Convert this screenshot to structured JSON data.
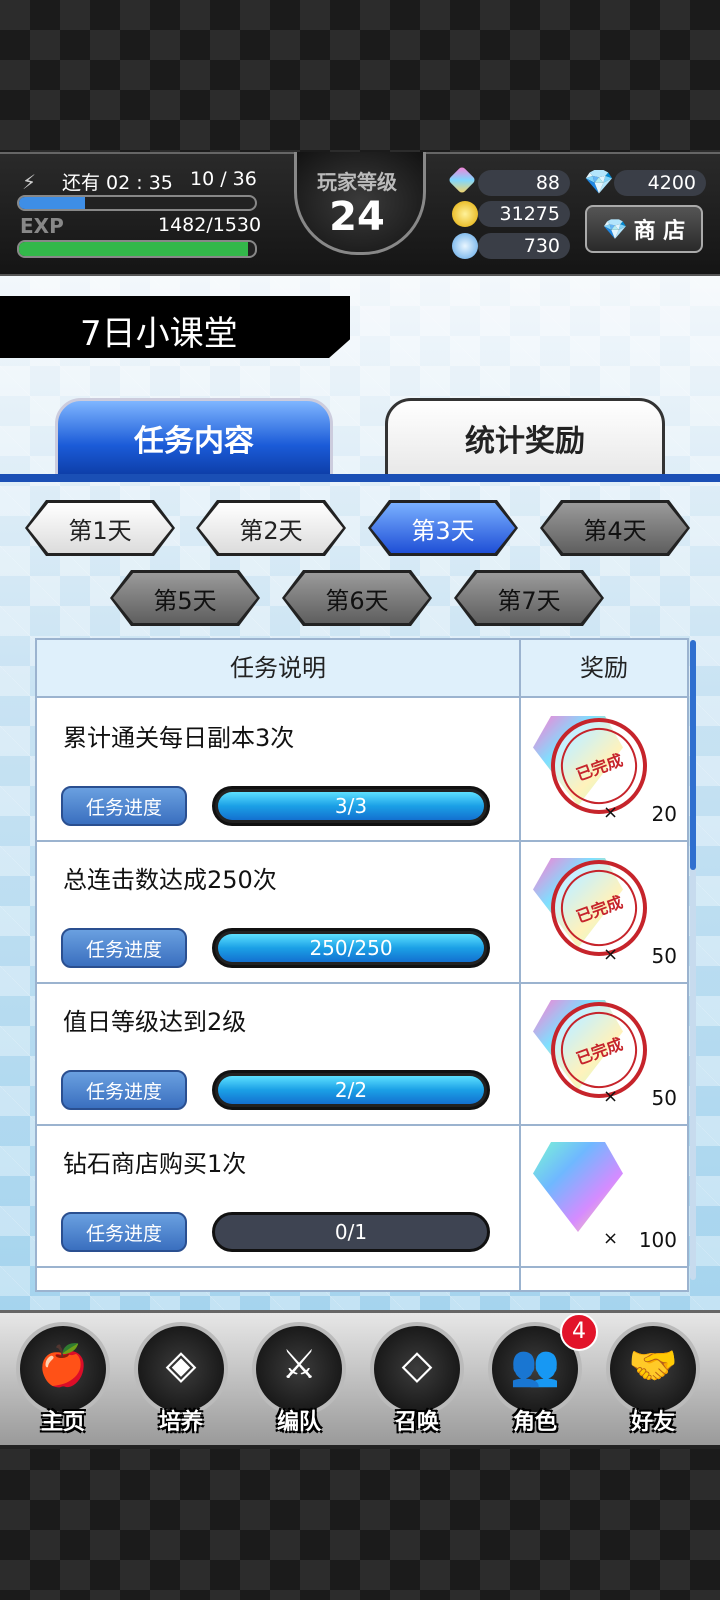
{
  "status": {
    "stamina_timer": "还有 02 : 35",
    "stamina_value": "10 / 36",
    "stamina_fill": 0.28,
    "exp_label": "EXP",
    "exp_value": "1482/1530",
    "exp_fill": 0.97,
    "level_label": "玩家等级",
    "level_value": "24"
  },
  "resources": {
    "crystal": "88",
    "gem": "4200",
    "gold": "31275",
    "orb": "730",
    "shop_label": "商 店"
  },
  "page_title": "7日小课堂",
  "tabs": {
    "tasks": "任务内容",
    "stats": "统计奖励"
  },
  "days": [
    {
      "label": "第1天",
      "state": "white"
    },
    {
      "label": "第2天",
      "state": "white"
    },
    {
      "label": "第3天",
      "state": "blue"
    },
    {
      "label": "第4天",
      "state": "gray"
    },
    {
      "label": "第5天",
      "state": "gray"
    },
    {
      "label": "第6天",
      "state": "gray"
    },
    {
      "label": "第7天",
      "state": "gray"
    }
  ],
  "table": {
    "col_task": "任务说明",
    "col_reward": "奖励",
    "progress_label": "任务进度",
    "times": "×",
    "stamp_text": "已完成",
    "rows": [
      {
        "task": "累计通关每日副本3次",
        "progress": "3/3",
        "fill": 1.0,
        "qty": "20",
        "reward_icon": "crystal-icon",
        "completed": true
      },
      {
        "task": "总连击数达成250次",
        "progress": "250/250",
        "fill": 1.0,
        "qty": "50",
        "reward_icon": "crystal-icon",
        "completed": true
      },
      {
        "task": "值日等级达到2级",
        "progress": "2/2",
        "fill": 1.0,
        "qty": "50",
        "reward_icon": "crystal-icon",
        "completed": true
      },
      {
        "task": "钻石商店购买1次",
        "progress": "0/1",
        "fill": 0.0,
        "qty": "100",
        "reward_icon": "diamond-icon",
        "completed": false
      }
    ]
  },
  "nav": {
    "home": "主页",
    "train": "培养",
    "team": "编队",
    "summon": "召唤",
    "character": "角色",
    "friends": "好友",
    "character_badge": "4"
  }
}
